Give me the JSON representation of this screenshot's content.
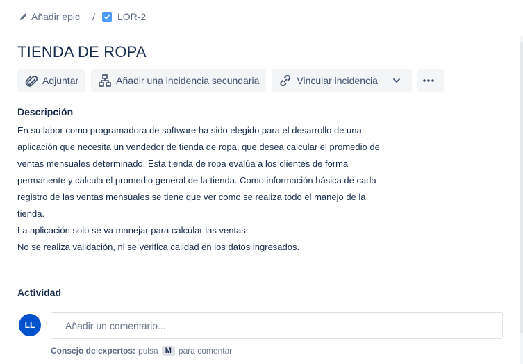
{
  "breadcrumb": {
    "add_epic": "Añadir epic",
    "separator": "/",
    "issue_key": "LOR-2"
  },
  "issue": {
    "title": "TIENDA DE ROPA"
  },
  "toolbar": {
    "attach": "Adjuntar",
    "add_child": "Añadir una incidencia secundaria",
    "link_issue": "Vincular incidencia"
  },
  "description": {
    "heading": "Descripción",
    "lines": [
      "En su labor como programadora de software ha sido elegido para el desarrollo de una",
      "aplicación que necesita un vendedor de tienda de ropa, que desea calcular el promedio de",
      "ventas mensuales determinado. Esta tienda de ropa evalúa a los clientes de forma",
      "permanente y calcula el promedio general de la tienda. Como información básica de cada",
      "registro de las ventas mensuales se tiene que ver como se realiza todo el manejo de la",
      "tienda.",
      " La aplicación solo se va manejar para calcular las ventas.",
      " No se realiza validación, ni se verifica calidad en los datos ingresados."
    ]
  },
  "activity": {
    "heading": "Actividad",
    "avatar_initials": "LL",
    "comment_placeholder": "Añadir un comentario...",
    "tip_label": "Consejo de expertos:",
    "tip_pre": "pulsa",
    "tip_key": "M",
    "tip_post": "para comentar"
  },
  "colors": {
    "text": "#172b4d",
    "subtle": "#5e6c84",
    "button_bg": "#f4f5f7",
    "checkbox": "#4c9aff",
    "avatar": "#0052cc"
  },
  "icons": [
    "pencil-icon",
    "checkbox-icon",
    "paperclip-icon",
    "hierarchy-icon",
    "link-icon",
    "chevron-down-icon",
    "more-icon"
  ]
}
